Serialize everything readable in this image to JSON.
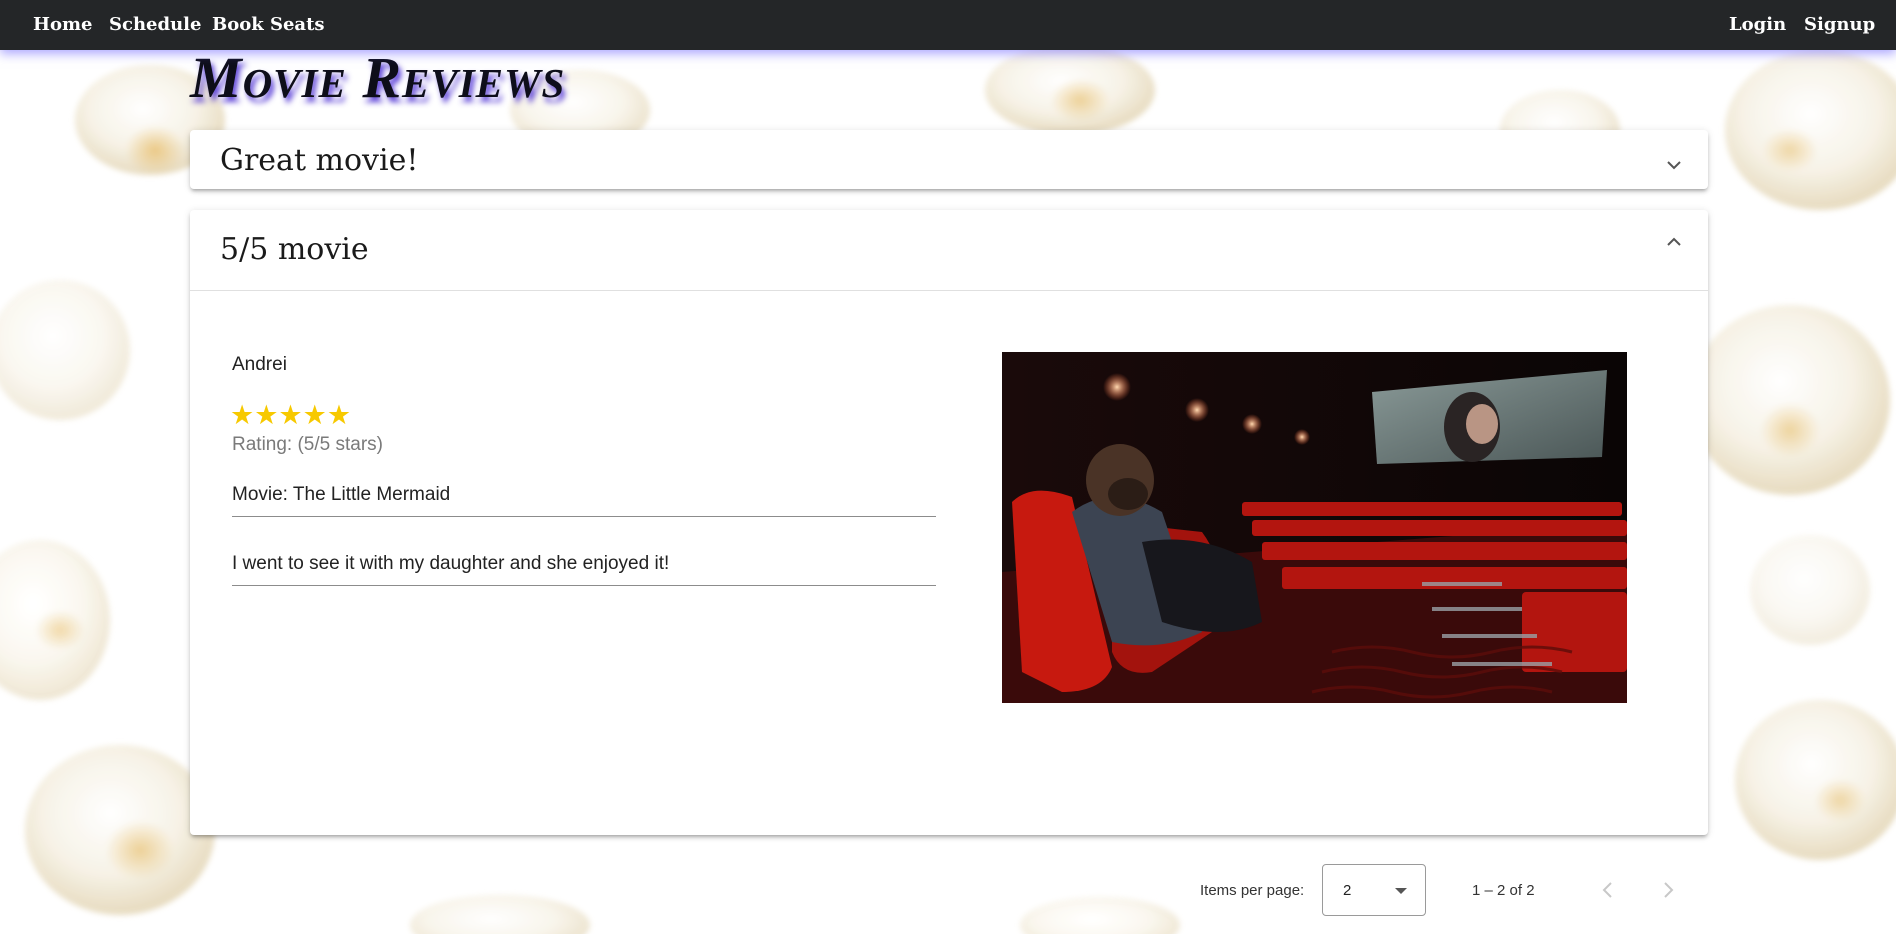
{
  "nav": {
    "home": "Home",
    "schedule": "Schedule",
    "book_seats": "Book Seats",
    "login": "Login",
    "signup": "Signup"
  },
  "page": {
    "title": "Movie Reviews"
  },
  "reviews": [
    {
      "title": "Great movie!",
      "expanded": false
    },
    {
      "title": "5/5 movie",
      "expanded": true,
      "reviewer": "Andrei",
      "stars": "★★★★★",
      "rating_value": 5,
      "rating_text": "Rating: (5/5 stars)",
      "movie": "Movie: The Little Mermaid",
      "comment": "I went to see it with my daughter and she enjoyed it!"
    }
  ],
  "paginator": {
    "items_per_page_label": "Items per page:",
    "items_per_page_value": "2",
    "range_label": "1 – 2 of 2"
  },
  "icons": {
    "expand": "chevron-down-icon",
    "collapse": "chevron-up-icon",
    "previous_page": "chevron-left-icon",
    "next_page": "chevron-right-icon",
    "dropdown": "caret-down-icon"
  },
  "colors": {
    "topbar": "#242628",
    "nav_glow": "#6e64ff",
    "title_shadow": "#4628d2",
    "star": "#f7c900",
    "panel": "#ffffff"
  }
}
